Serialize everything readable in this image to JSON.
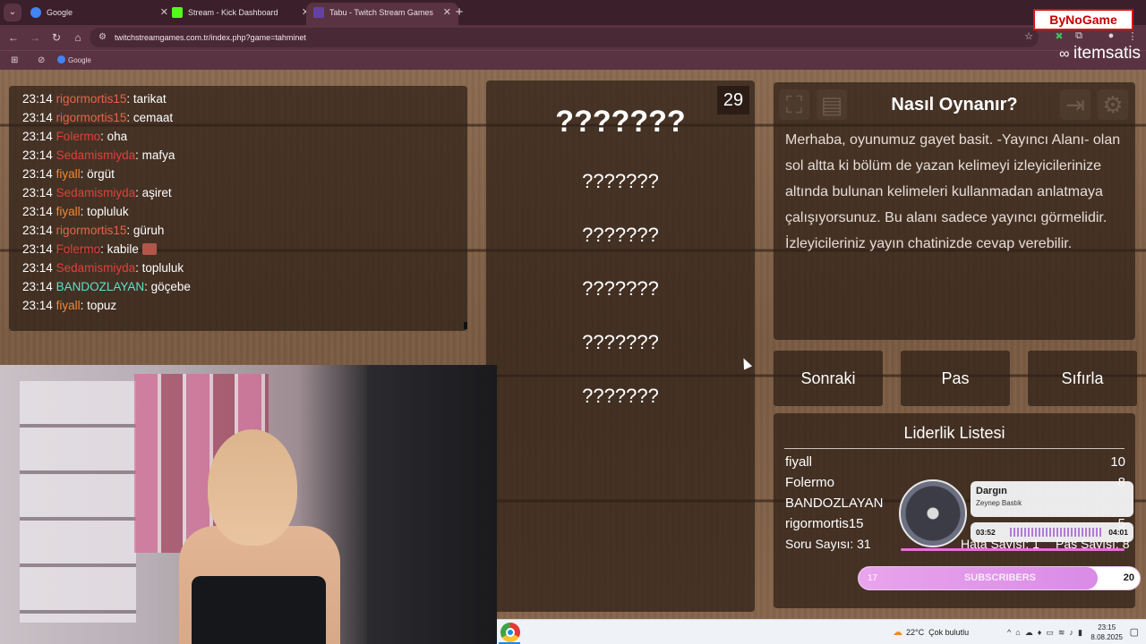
{
  "browser": {
    "tabs": [
      {
        "label": "Google",
        "color": "#4285f4"
      },
      {
        "label": "Stream - Kick Dashboard",
        "color": "#53fc18"
      },
      {
        "label": "Tabu - Twitch Stream Games",
        "color": "#6441a5"
      }
    ],
    "active_tab": 2,
    "url": "twitchstreamgames.com.tr/index.php?game=tahminet",
    "bookmark": "Google"
  },
  "overlays": {
    "bynogame": "ByNoGame",
    "itemsatis": "itemsatis"
  },
  "chat": {
    "messages": [
      {
        "time": "23:14",
        "user": "rigormortis15",
        "color": "#e8624a",
        "text": ": tarikat"
      },
      {
        "time": "23:14",
        "user": "rigormortis15",
        "color": "#e8624a",
        "text": ": cemaat"
      },
      {
        "time": "23:14",
        "user": "Folermo",
        "color": "#e0403a",
        "text": ": oha"
      },
      {
        "time": "23:14",
        "user": "Sedamismiyda",
        "color": "#e0403a",
        "text": ": mafya"
      },
      {
        "time": "23:14",
        "user": "fiyall",
        "color": "#f08a35",
        "text": ": örgüt"
      },
      {
        "time": "23:14",
        "user": "Sedamismiyda",
        "color": "#e0403a",
        "text": ": aşiret"
      },
      {
        "time": "23:14",
        "user": "fiyall",
        "color": "#f08a35",
        "text": ": topluluk"
      },
      {
        "time": "23:14",
        "user": "rigormortis15",
        "color": "#e8624a",
        "text": ": güruh"
      },
      {
        "time": "23:14",
        "user": "Folermo",
        "color": "#e0403a",
        "text": ": kabile"
      },
      {
        "time": "23:14",
        "user": "Sedamismiyda",
        "color": "#e0403a",
        "text": ": topluluk"
      },
      {
        "time": "23:14",
        "user": "BANDOZLAYAN",
        "color": "#5ee0c9",
        "text": ": göçebe"
      },
      {
        "time": "23:14",
        "user": "fiyall",
        "color": "#f08a35",
        "text": ": topuz"
      }
    ]
  },
  "card": {
    "timer": "29",
    "word": "???????",
    "taboo": [
      "???????",
      "???????",
      "???????",
      "???????",
      "???????"
    ]
  },
  "help": {
    "title": "Nasıl Oynanır?",
    "text": "Merhaba, oyunumuz gayet basit. -Yayıncı Alanı- olan sol altta ki bölüm de yazan kelimeyi izleyicilerinize altında bulunan kelimeleri kullanmadan anlatmaya çalışıyorsunuz. Bu alanı sadece yayıncı görmelidir. İzleyicileriniz yayın chatinizde cevap verebilir."
  },
  "buttons": {
    "next": "Sonraki",
    "pass": "Pas",
    "reset": "Sıfırla"
  },
  "leaderboard": {
    "title": "Liderlik Listesi",
    "rows": [
      {
        "name": "fiyall",
        "score": "10"
      },
      {
        "name": "Folermo",
        "score": "8"
      },
      {
        "name": "BANDOZLAYAN",
        "score": ""
      },
      {
        "name": "rigormortis15",
        "score": "5"
      }
    ],
    "questions": "Soru Sayısı: 31",
    "errors": "Hata Sayısı: 1",
    "passes": "Pas Sayısı: 8"
  },
  "music": {
    "title": "Dargın",
    "artist": "Zeynep Bastık",
    "elapsed": "03:52",
    "total": "04:01",
    "progress": 0.96
  },
  "subscribers": {
    "current": "17",
    "label": "SUBSCRIBERS",
    "goal": "20",
    "fill": 0.85
  },
  "taskbar": {
    "temperature": "22°C",
    "weather": "Çok bulutlu",
    "time": "23:15",
    "date": "8.08.2025"
  }
}
